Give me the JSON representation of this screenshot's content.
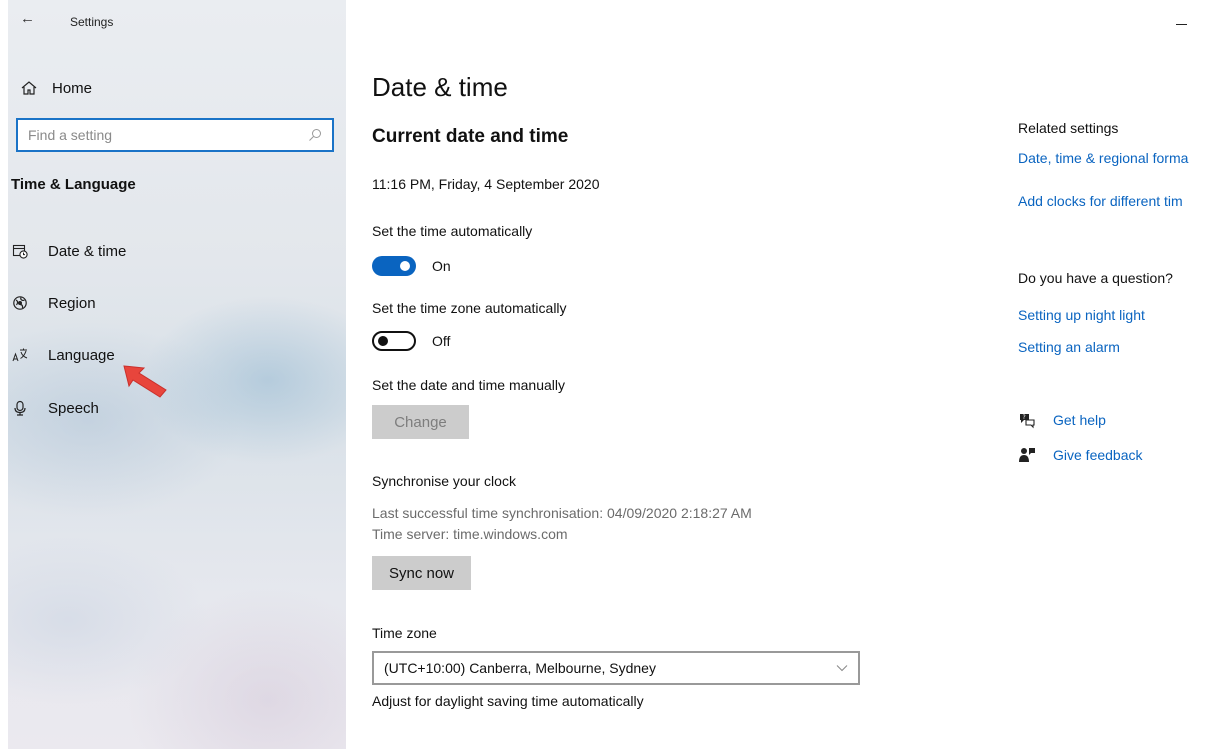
{
  "window": {
    "title": "Settings",
    "back_glyph": "←",
    "minimize_icon": "minimize-icon"
  },
  "sidebar": {
    "home_label": "Home",
    "search_placeholder": "Find a setting",
    "section_title": "Time & Language",
    "items": [
      {
        "label": "Date & time",
        "icon": "calendar-clock-icon"
      },
      {
        "label": "Region",
        "icon": "globe-icon"
      },
      {
        "label": "Language",
        "icon": "language-icon"
      },
      {
        "label": "Speech",
        "icon": "microphone-icon"
      }
    ]
  },
  "main": {
    "page_title": "Date & time",
    "current_section": "Current date and time",
    "current_datetime": "11:16 PM, Friday, 4 September 2020",
    "auto_time_label": "Set the time automatically",
    "auto_time_state": "On",
    "auto_tz_label": "Set the time zone automatically",
    "auto_tz_state": "Off",
    "manual_label": "Set the date and time manually",
    "change_button": "Change",
    "sync_title": "Synchronise your clock",
    "sync_last": "Last successful time synchronisation: 04/09/2020 2:18:27 AM",
    "sync_server": "Time server: time.windows.com",
    "sync_button": "Sync now",
    "timezone_label": "Time zone",
    "timezone_value": "(UTC+10:00) Canberra, Melbourne, Sydney",
    "dst_label": "Adjust for daylight saving time automatically"
  },
  "right": {
    "related_title": "Related settings",
    "related_links": [
      "Date, time & regional forma",
      "Add clocks for different tim"
    ],
    "question_title": "Do you have a question?",
    "question_links": [
      "Setting up night light",
      "Setting an alarm"
    ],
    "help_label": "Get help",
    "feedback_label": "Give feedback"
  },
  "colors": {
    "accent": "#0a64c0",
    "search_border": "#1a73c7",
    "cursor_arrow": "#e8453c"
  }
}
